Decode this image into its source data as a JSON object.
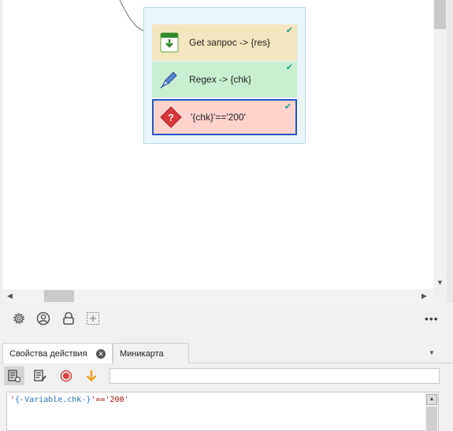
{
  "canvas": {
    "actions": [
      {
        "label": "Get запрос -> {res}",
        "icon": "download-icon",
        "status": "check-icon"
      },
      {
        "label": "Regex -> {chk}",
        "icon": "pen-icon",
        "status": "check-icon"
      },
      {
        "label": "'{chk}'=='200'",
        "icon": "question-diamond-icon",
        "status": "check-icon"
      }
    ]
  },
  "toolbar": {
    "icons": [
      "settings-gear-icon",
      "user-circle-icon",
      "lock-icon",
      "add-square-icon",
      "more-icon"
    ],
    "more_label": "•••"
  },
  "panel": {
    "tabs": [
      {
        "label": "Свойства действия",
        "active": true
      },
      {
        "label": "Миникарта",
        "active": false
      }
    ]
  },
  "editor": {
    "input_value": "",
    "code": {
      "q1": "'",
      "v_open": "{-",
      "var": "Variable.chk",
      "v_close": "-}",
      "rest": "'=='200'"
    }
  },
  "colors": {
    "get_bg": "#f3e6bf",
    "regex_bg": "#c9efd0",
    "if_bg": "#ffd2cc",
    "selected_border": "#2357c8",
    "check": "#1aa08a"
  }
}
